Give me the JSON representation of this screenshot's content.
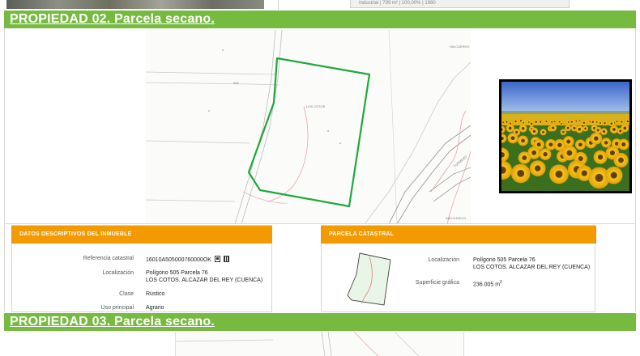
{
  "previous": {
    "table_fragment": "Industrial | 799 m² | 100,00% | 1980"
  },
  "property_02": {
    "title": "PROPIEDAD  02. Parcela secano.",
    "map_labels": {
      "parcel_name": "LOS COTOS",
      "road_top": "VALCUERVO",
      "road_num": "505",
      "road_side": "TURMERO",
      "road_bottom": "VALLEJUELO"
    },
    "descriptive": {
      "header": "DATOS DESCRIPTIVOS DEL INMUEBLE",
      "rows": [
        {
          "label": "Referencia catastral",
          "value": "16010A505000760000OK"
        },
        {
          "label": "Localización",
          "value": "Polígono 505 Parcela 76",
          "value2": "LOS COTOS. ALCAZAR DEL REY (CUENCA)"
        },
        {
          "label": "Clase",
          "value": "Rústico"
        },
        {
          "label": "Uso principal",
          "value": "Agrario"
        }
      ]
    },
    "cadastral": {
      "header": "PARCELA CATASTRAL",
      "location_label": "Localización",
      "location_value": "Polígono 505 Parcela 76",
      "location_value2": "LOS COTOS. ALCAZAR DEL REY (CUENCA)",
      "surface_label": "Superficie gráfica",
      "surface_value": "236.005 m",
      "surface_unit_sup": "2"
    },
    "colors": {
      "banner": "#76bb3f",
      "panel_header": "#f39a00",
      "parcel_outline": "#1fa83a"
    }
  },
  "property_03": {
    "title": "PROPIEDAD  03. Parcela secano."
  }
}
